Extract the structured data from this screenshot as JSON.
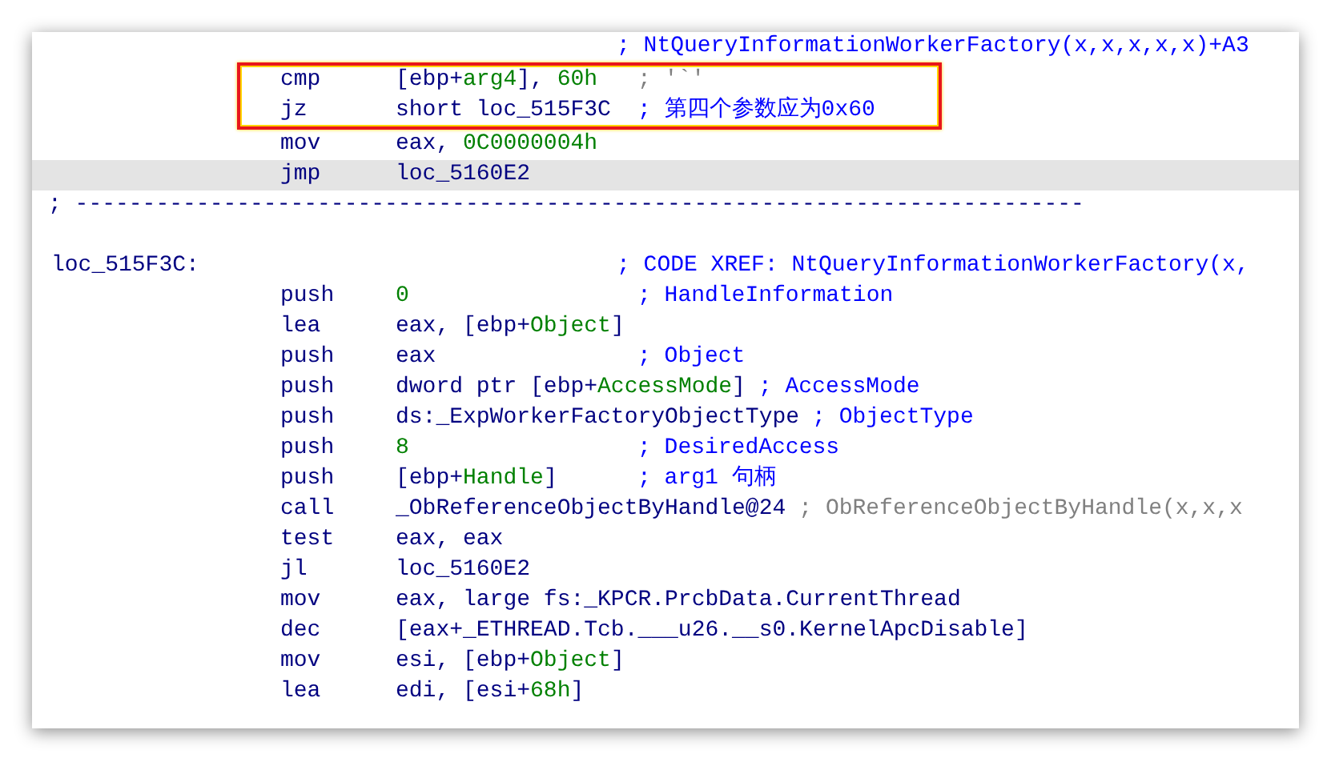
{
  "lines": [
    {
      "kind": "comment",
      "comment": [
        {
          "text": "; NtQueryInformationWorkerFactory(x,x,x,x,x)+A3",
          "kind": "comment"
        }
      ]
    },
    {
      "kind": "insn",
      "boxed": true,
      "mnemonic": "cmp",
      "operand": [
        {
          "text": "[ebp+",
          "kind": "plain"
        },
        {
          "text": "arg4",
          "kind": "number"
        },
        {
          "text": "], ",
          "kind": "plain"
        },
        {
          "text": "60h",
          "kind": "number"
        }
      ],
      "comment": [
        {
          "text": "; '`'",
          "kind": "auto"
        }
      ]
    },
    {
      "kind": "insn",
      "boxed": true,
      "mnemonic": "jz",
      "operand": [
        {
          "text": "short loc_515F3C",
          "kind": "plain"
        }
      ],
      "comment": [
        {
          "text": "; 第四个参数应为0x60",
          "kind": "comment"
        }
      ]
    },
    {
      "kind": "insn",
      "mnemonic": "mov",
      "operand": [
        {
          "text": "eax, ",
          "kind": "plain"
        },
        {
          "text": "0C0000004h",
          "kind": "number"
        }
      ]
    },
    {
      "kind": "insn",
      "selected": true,
      "mnemonic": "jmp",
      "operand": [
        {
          "text": "loc_5160E2",
          "kind": "plain"
        }
      ]
    },
    {
      "kind": "separator",
      "text": "; ---------------------------------------------------------------------------"
    },
    {
      "kind": "blank"
    },
    {
      "kind": "label",
      "label": "loc_515F3C:",
      "comment": [
        {
          "text": "; CODE XREF: NtQueryInformationWorkerFactory(x,",
          "kind": "comment"
        }
      ]
    },
    {
      "kind": "insn",
      "mnemonic": "push",
      "operand": [
        {
          "text": "0",
          "kind": "number"
        }
      ],
      "comment": [
        {
          "text": "; HandleInformation",
          "kind": "comment"
        }
      ]
    },
    {
      "kind": "insn",
      "mnemonic": "lea",
      "operand": [
        {
          "text": "eax, [ebp+",
          "kind": "plain"
        },
        {
          "text": "Object",
          "kind": "number"
        },
        {
          "text": "]",
          "kind": "plain"
        }
      ]
    },
    {
      "kind": "insn",
      "mnemonic": "push",
      "operand": [
        {
          "text": "eax",
          "kind": "plain"
        }
      ],
      "comment": [
        {
          "text": "; Object",
          "kind": "comment"
        }
      ]
    },
    {
      "kind": "insn",
      "mnemonic": "push",
      "operand": [
        {
          "text": "dword ptr [ebp+",
          "kind": "plain"
        },
        {
          "text": "AccessMode",
          "kind": "number"
        },
        {
          "text": "]",
          "kind": "plain"
        }
      ],
      "comment": [
        {
          "text": "; AccessMode",
          "kind": "comment"
        }
      ]
    },
    {
      "kind": "insn",
      "mnemonic": "push",
      "operand": [
        {
          "text": "ds:_ExpWorkerFactoryObjectType",
          "kind": "plain"
        }
      ],
      "comment": [
        {
          "text": "; ObjectType",
          "kind": "comment"
        }
      ]
    },
    {
      "kind": "insn",
      "mnemonic": "push",
      "operand": [
        {
          "text": "8",
          "kind": "number"
        }
      ],
      "comment": [
        {
          "text": "; DesiredAccess",
          "kind": "comment"
        }
      ]
    },
    {
      "kind": "insn",
      "mnemonic": "push",
      "operand": [
        {
          "text": "[ebp+",
          "kind": "plain"
        },
        {
          "text": "Handle",
          "kind": "number"
        },
        {
          "text": "]",
          "kind": "plain"
        }
      ],
      "comment": [
        {
          "text": "; arg1 句柄",
          "kind": "comment"
        }
      ]
    },
    {
      "kind": "insn",
      "mnemonic": "call",
      "operand": [
        {
          "text": "_ObReferenceObjectByHandle@24",
          "kind": "plain"
        }
      ],
      "comment": [
        {
          "text": ";",
          "kind": "auto"
        },
        {
          "text": " ObReferenceObjectByHandle(x,x,x",
          "kind": "auto"
        }
      ]
    },
    {
      "kind": "insn",
      "mnemonic": "test",
      "operand": [
        {
          "text": "eax, eax",
          "kind": "plain"
        }
      ]
    },
    {
      "kind": "insn",
      "mnemonic": "jl",
      "operand": [
        {
          "text": "loc_5160E2",
          "kind": "plain"
        }
      ]
    },
    {
      "kind": "insn",
      "mnemonic": "mov",
      "operand": [
        {
          "text": "eax, large fs:_KPCR.PrcbData.CurrentThread",
          "kind": "plain"
        }
      ]
    },
    {
      "kind": "insn",
      "mnemonic": "dec",
      "operand": [
        {
          "text": "[eax+_ETHREAD.Tcb.___u26.__s0.KernelApcDisable]",
          "kind": "plain"
        }
      ]
    },
    {
      "kind": "insn",
      "mnemonic": "mov",
      "operand": [
        {
          "text": "esi, [ebp+",
          "kind": "plain"
        },
        {
          "text": "Object",
          "kind": "number"
        },
        {
          "text": "]",
          "kind": "plain"
        }
      ]
    },
    {
      "kind": "insn",
      "mnemonic": "lea",
      "operand": [
        {
          "text": "edi, [esi+",
          "kind": "plain"
        },
        {
          "text": "68h",
          "kind": "number"
        },
        {
          "text": "]",
          "kind": "plain"
        }
      ]
    }
  ]
}
